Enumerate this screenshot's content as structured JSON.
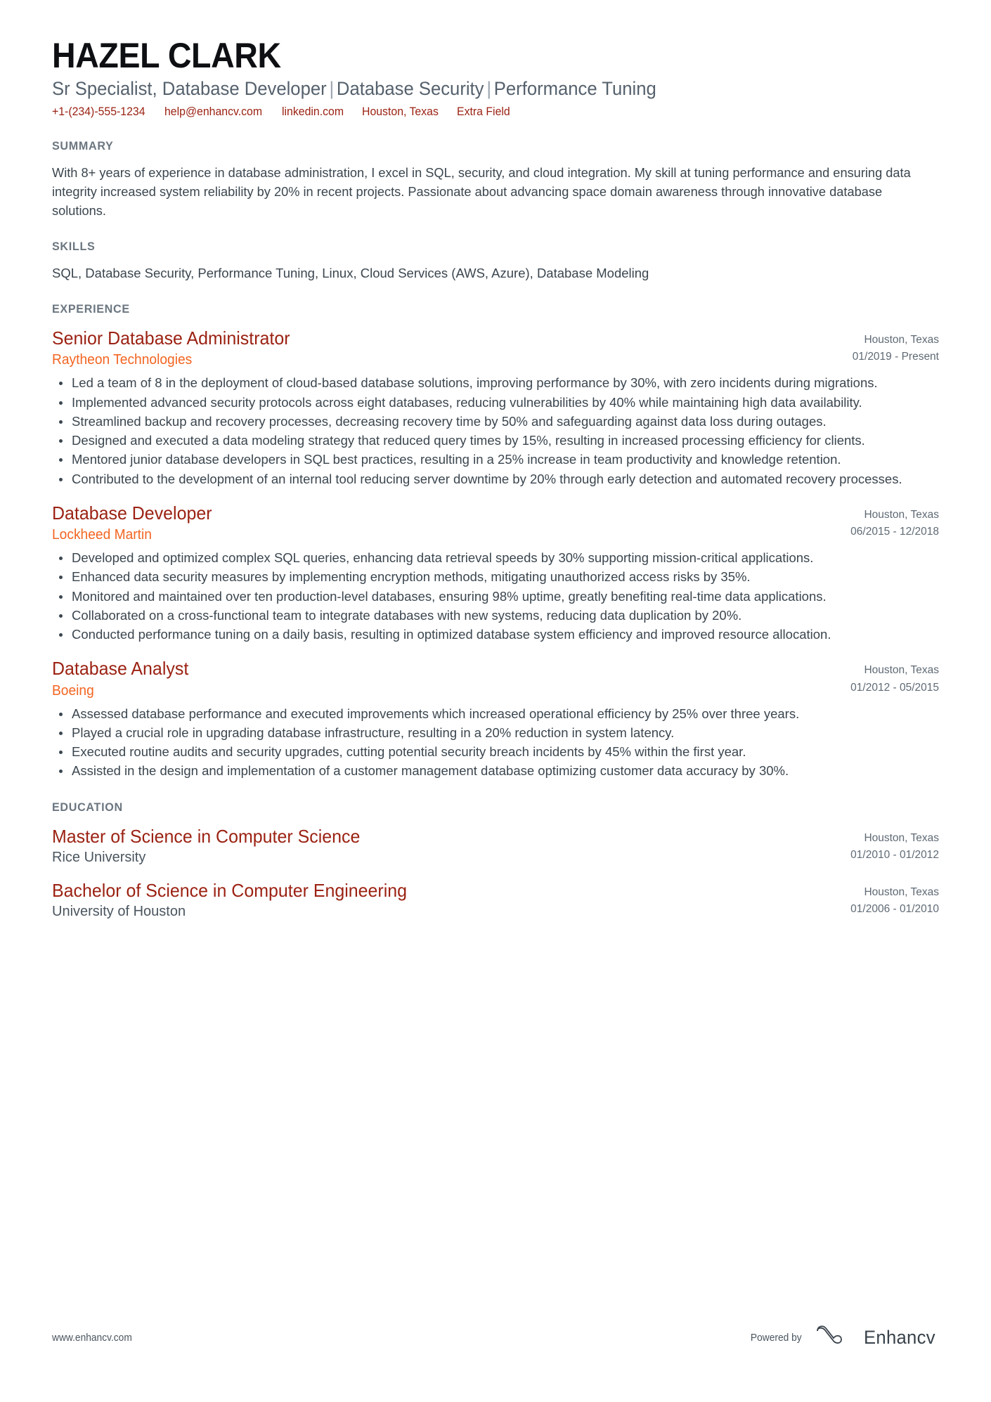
{
  "header": {
    "name": "HAZEL CLARK",
    "headline_parts": [
      "Sr Specialist, Database Developer",
      "Database Security",
      "Performance Tuning"
    ],
    "headline_separator": "|",
    "contact": [
      {
        "icon": "phone-icon",
        "text": "+1-(234)-555-1234"
      },
      {
        "icon": "email-icon",
        "text": "help@enhancv.com"
      },
      {
        "icon": "link-icon",
        "text": "linkedin.com"
      },
      {
        "icon": "location-icon",
        "text": "Houston, Texas"
      },
      {
        "icon": "info-icon",
        "text": "Extra Field"
      }
    ],
    "accent_color": "#9b2213"
  },
  "summary": {
    "title": "SUMMARY",
    "text": "With 8+ years of experience in database administration, I excel in SQL, security, and cloud integration. My skill at tuning performance and ensuring data integrity increased system reliability by 20% in recent projects. Passionate about advancing space domain awareness through innovative database solutions."
  },
  "skills": {
    "title": "SKILLS",
    "text": "SQL, Database Security, Performance Tuning, Linux, Cloud Services (AWS, Azure), Database Modeling"
  },
  "experience": {
    "title": "EXPERIENCE",
    "entries": [
      {
        "role": "Senior Database Administrator",
        "company": "Raytheon Technologies",
        "location": "Houston, Texas",
        "dates": "01/2019 - Present",
        "bullets": [
          "Led a team of 8 in the deployment of cloud-based database solutions, improving performance by 30%, with zero incidents during migrations.",
          "Implemented advanced security protocols across eight databases, reducing vulnerabilities by 40% while maintaining high data availability.",
          "Streamlined backup and recovery processes, decreasing recovery time by 50% and safeguarding against data loss during outages.",
          "Designed and executed a data modeling strategy that reduced query times by 15%, resulting in increased processing efficiency for clients.",
          "Mentored junior database developers in SQL best practices, resulting in a 25% increase in team productivity and knowledge retention.",
          "Contributed to the development of an internal tool reducing server downtime by 20% through early detection and automated recovery processes."
        ]
      },
      {
        "role": "Database Developer",
        "company": "Lockheed Martin",
        "location": "Houston, Texas",
        "dates": "06/2015 - 12/2018",
        "bullets": [
          "Developed and optimized complex SQL queries, enhancing data retrieval speeds by 30% supporting mission-critical applications.",
          "Enhanced data security measures by implementing encryption methods, mitigating unauthorized access risks by 35%.",
          "Monitored and maintained over ten production-level databases, ensuring 98% uptime, greatly benefiting real-time data applications.",
          "Collaborated on a cross-functional team to integrate databases with new systems, reducing data duplication by 20%.",
          "Conducted performance tuning on a daily basis, resulting in optimized database system efficiency and improved resource allocation."
        ]
      },
      {
        "role": "Database Analyst",
        "company": "Boeing",
        "location": "Houston, Texas",
        "dates": "01/2012 - 05/2015",
        "bullets": [
          "Assessed database performance and executed improvements which increased operational efficiency by 25% over three years.",
          "Played a crucial role in upgrading database infrastructure, resulting in a 20% reduction in system latency.",
          "Executed routine audits and security upgrades, cutting potential security breach incidents by 45% within the first year.",
          "Assisted in the design and implementation of a customer management database optimizing customer data accuracy by 30%."
        ]
      }
    ]
  },
  "education": {
    "title": "EDUCATION",
    "entries": [
      {
        "degree": "Master of Science in Computer Science",
        "school": "Rice University",
        "location": "Houston, Texas",
        "dates": "01/2010 - 01/2012"
      },
      {
        "degree": "Bachelor of Science in Computer Engineering",
        "school": "University of Houston",
        "location": "Houston, Texas",
        "dates": "01/2006 - 01/2010"
      }
    ]
  },
  "footer": {
    "url": "www.enhancv.com",
    "powered_by": "Powered by",
    "brand": "Enhancv"
  }
}
